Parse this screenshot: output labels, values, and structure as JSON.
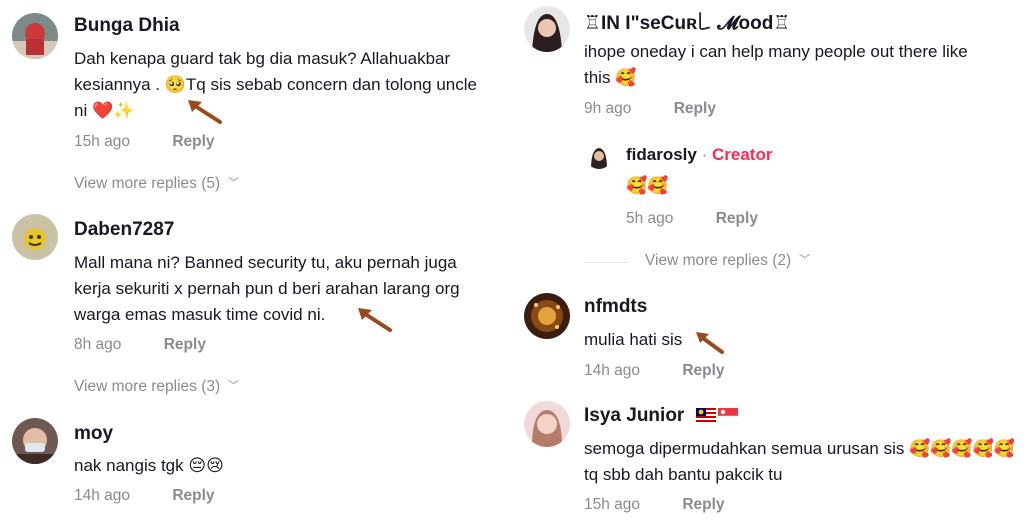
{
  "left": {
    "comments": [
      {
        "username": "Bunga Dhia",
        "lines": [
          "Dah kenapa guard tak bg dia masuk? Allahuakbar",
          "kesiannya . 🥺Tq sis sebab concern dan tolong uncle",
          "ni ❤️✨"
        ],
        "time": "15h ago",
        "reply": "Reply",
        "more_replies": "View more replies (5)"
      },
      {
        "username": "Daben7287",
        "lines": [
          "Mall mana ni? Banned security tu, aku pernah juga",
          "kerja sekuriti x pernah pun d beri arahan larang org",
          "warga emas masuk time covid ni."
        ],
        "time": "8h ago",
        "reply": "Reply",
        "more_replies": "View more replies (3)"
      },
      {
        "username": "moy",
        "lines": [
          "nak nangis tgk 😔😢"
        ],
        "time": "14h ago",
        "reply": "Reply"
      }
    ]
  },
  "right": {
    "comments": [
      {
        "username": "♖IN I\"seCuʀ꒒ 𝓜ood♖",
        "lines": [
          "ihope oneday i can help many people out there like",
          "this 🥰"
        ],
        "time": "9h ago",
        "reply": "Reply"
      },
      {
        "username": "nfmdts",
        "lines": [
          "mulia hati sis"
        ],
        "time": "14h ago",
        "reply": "Reply"
      },
      {
        "username": "Isya Junior",
        "lines": [
          "semoga dipermudahkan semua urusan sis 🥰🥰🥰🥰🥰",
          "tq sbb dah bantu pakcik tu"
        ],
        "time": "15h ago",
        "reply": "Reply"
      }
    ],
    "reply": {
      "username": "fidarosly",
      "separator": "·",
      "badge": "Creator",
      "text": "🥰🥰",
      "time": "5h ago",
      "reply": "Reply"
    },
    "more_replies": "View more replies (2)"
  },
  "icons": {
    "chevron": "chevron-down-icon",
    "arrow": "annotation-arrow-icon"
  },
  "colors": {
    "creator": "#fe2c55",
    "meta": "#8a8b91",
    "arrow": "#9b4a1f"
  }
}
